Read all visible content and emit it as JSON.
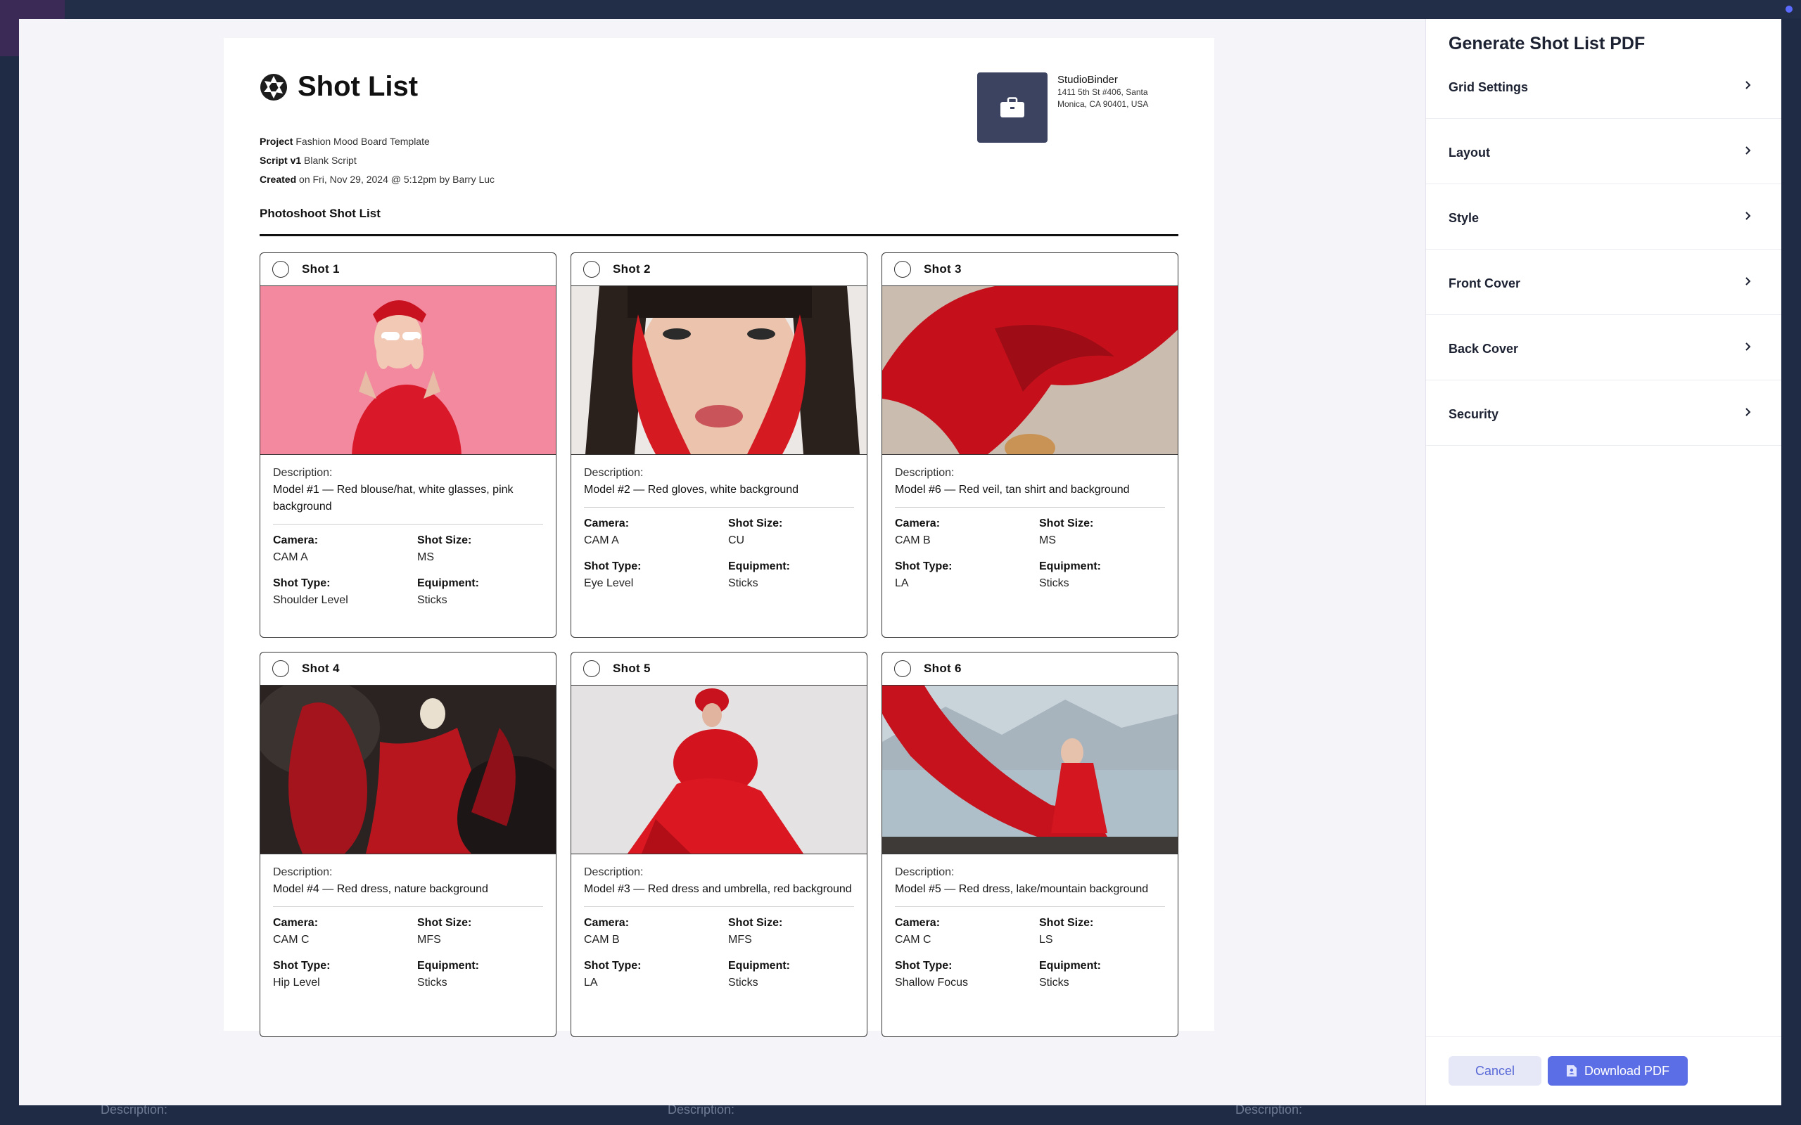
{
  "background": {
    "bottom_texts": [
      "Description:",
      "Description:",
      "Description:"
    ]
  },
  "document": {
    "title": "Shot List",
    "meta": {
      "project_label": "Project",
      "project_value": "Fashion Mood Board Template",
      "script_label": "Script v1",
      "script_value": "Blank Script",
      "created_label": "Created",
      "created_value": "on Fri, Nov 29, 2024 @ 5:12pm by Barry Luc"
    },
    "company": {
      "name": "StudioBinder",
      "address_line1": "1411 5th St #406, Santa",
      "address_line2": "Monica, CA 90401, USA"
    },
    "section_title": "Photoshoot Shot List",
    "field_labels": {
      "description": "Description:",
      "camera": "Camera:",
      "shot_size": "Shot Size:",
      "shot_type": "Shot Type:",
      "equipment": "Equipment:"
    },
    "shots": [
      {
        "label": "Shot  1",
        "description": "Model #1 — Red blouse/hat, white glasses, pink background",
        "camera": "CAM A",
        "shot_size": "MS",
        "shot_type": "Shoulder Level",
        "equipment": "Sticks"
      },
      {
        "label": "Shot  2",
        "description": "Model #2 — Red gloves, white background",
        "camera": "CAM A",
        "shot_size": "CU",
        "shot_type": "Eye Level",
        "equipment": "Sticks"
      },
      {
        "label": "Shot  3",
        "description": "Model #6 — Red veil, tan shirt and background",
        "camera": "CAM B",
        "shot_size": "MS",
        "shot_type": "LA",
        "equipment": "Sticks"
      },
      {
        "label": "Shot  4",
        "description": "Model #4 — Red dress, nature background",
        "camera": "CAM C",
        "shot_size": "MFS",
        "shot_type": "Hip Level",
        "equipment": "Sticks"
      },
      {
        "label": "Shot  5",
        "description": "Model #3 — Red dress and umbrella, red background",
        "camera": "CAM B",
        "shot_size": "MFS",
        "shot_type": "LA",
        "equipment": "Sticks"
      },
      {
        "label": "Shot  6",
        "description": "Model #5 — Red dress, lake/mountain background",
        "camera": "CAM C",
        "shot_size": "LS",
        "shot_type": "Shallow Focus",
        "equipment": "Sticks"
      }
    ]
  },
  "panel": {
    "title": "Generate Shot List PDF",
    "sections": [
      "Grid Settings",
      "Layout",
      "Style",
      "Front Cover",
      "Back Cover",
      "Security"
    ],
    "cancel_label": "Cancel",
    "download_label": "Download PDF"
  },
  "colors": {
    "primary": "#5c6ee6",
    "cancel_bg": "#e6e8f7",
    "backdrop": "#1f2b45"
  }
}
